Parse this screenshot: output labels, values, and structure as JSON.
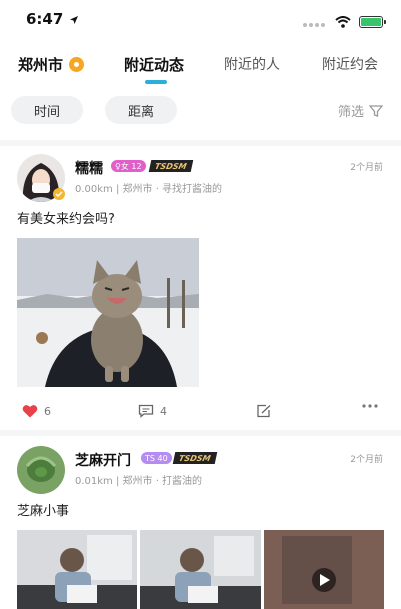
{
  "status_bar": {
    "time": "6:47",
    "battery_level": 1.0,
    "icons": [
      "location-arrow-icon",
      "wifi-icon",
      "battery-charging-icon"
    ]
  },
  "nav": {
    "city": "郑州市",
    "tabs": [
      {
        "label": "附近动态",
        "active": true
      },
      {
        "label": "附近的人",
        "active": false
      },
      {
        "label": "附近约会",
        "active": false
      }
    ]
  },
  "filters": {
    "time_label": "时间",
    "distance_label": "距离",
    "filter_label": "筛选"
  },
  "posts": [
    {
      "username": "糯糯",
      "gender_badge": "♀女 12",
      "vip_badge": "TSDSM",
      "time": "2个月前",
      "meta": "0.00km | 郑州市 · 寻找打酱油的",
      "text": "有美女来约会吗?",
      "likes": "6",
      "comments": "4"
    },
    {
      "username": "芝麻开门",
      "gender_badge": "TS 40",
      "vip_badge": "TSDSM",
      "time": "2个月前",
      "meta": "0.01km | 郑州市 · 打酱油的",
      "text": "芝麻小事"
    }
  ],
  "colors": {
    "accent": "#2ab0d8",
    "like": "#e8414a",
    "gender_female": "#e05fc8",
    "gender_ts": "#b58cf0",
    "vip_gold": "#e8c574"
  }
}
